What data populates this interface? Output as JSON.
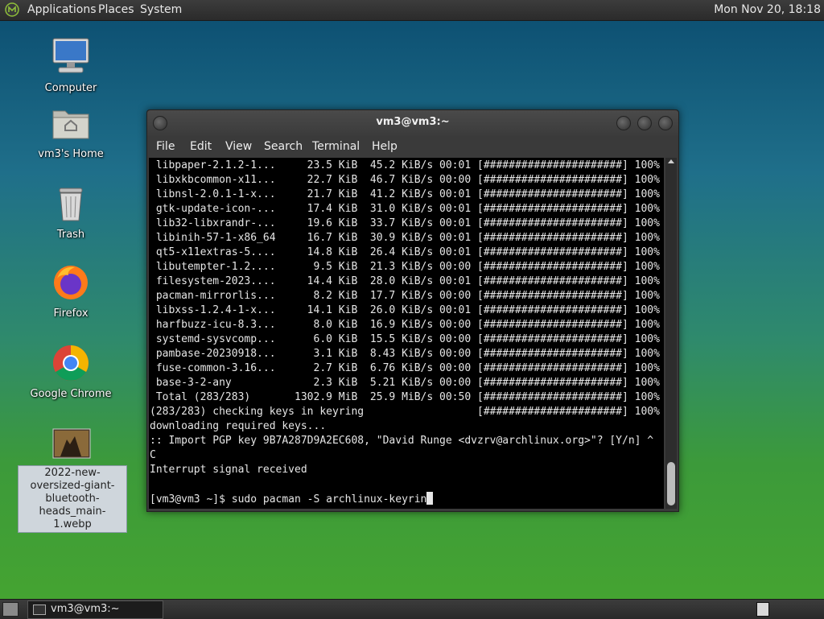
{
  "top_panel": {
    "menus": [
      "Applications",
      "Places",
      "System"
    ],
    "clock": "Mon Nov 20, 18:18"
  },
  "desktop_icons": {
    "computer": "Computer",
    "home": "vm3's Home",
    "trash": "Trash",
    "firefox": "Firefox",
    "chrome": "Google Chrome",
    "image_file": "2022-new-oversized-giant-bluetooth-heads_main-1.webp"
  },
  "terminal": {
    "title": "vm3@vm3:~",
    "menu": [
      "File",
      "Edit",
      "View",
      "Search",
      "Terminal",
      "Help"
    ],
    "lines": [
      " libpaper-2.1.2-1...     23.5 KiB  45.2 KiB/s 00:01 [######################] 100%",
      " libxkbcommon-x11...     22.7 KiB  46.7 KiB/s 00:00 [######################] 100%",
      " libnsl-2.0.1-1-x...     21.7 KiB  41.2 KiB/s 00:01 [######################] 100%",
      " gtk-update-icon-...     17.4 KiB  31.0 KiB/s 00:01 [######################] 100%",
      " lib32-libxrandr-...     19.6 KiB  33.7 KiB/s 00:01 [######################] 100%",
      " libinih-57-1-x86_64     16.7 KiB  30.9 KiB/s 00:01 [######################] 100%",
      " qt5-x11extras-5....     14.8 KiB  26.4 KiB/s 00:01 [######################] 100%",
      " libutempter-1.2....      9.5 KiB  21.3 KiB/s 00:00 [######################] 100%",
      " filesystem-2023....     14.4 KiB  28.0 KiB/s 00:01 [######################] 100%",
      " pacman-mirrorlis...      8.2 KiB  17.7 KiB/s 00:00 [######################] 100%",
      " libxss-1.2.4-1-x...     14.1 KiB  26.0 KiB/s 00:01 [######################] 100%",
      " harfbuzz-icu-8.3...      8.0 KiB  16.9 KiB/s 00:00 [######################] 100%",
      " systemd-sysvcomp...      6.0 KiB  15.5 KiB/s 00:00 [######################] 100%",
      " pambase-20230918...      3.1 KiB  8.43 KiB/s 00:00 [######################] 100%",
      " fuse-common-3.16...      2.7 KiB  6.76 KiB/s 00:00 [######################] 100%",
      " base-3-2-any             2.3 KiB  5.21 KiB/s 00:00 [######################] 100%",
      " Total (283/283)       1302.9 MiB  25.9 MiB/s 00:50 [######################] 100%",
      "(283/283) checking keys in keyring                  [######################] 100%",
      "downloading required keys...",
      ":: Import PGP key 9B7A287D9A2EC608, \"David Runge <dvzrv@archlinux.org>\"? [Y/n] ^",
      "C",
      "Interrupt signal received",
      ""
    ],
    "prompt": "[vm3@vm3 ~]$ sudo pacman -S archlinux-keyrin"
  },
  "taskbar": {
    "window_button": "vm3@vm3:~"
  }
}
